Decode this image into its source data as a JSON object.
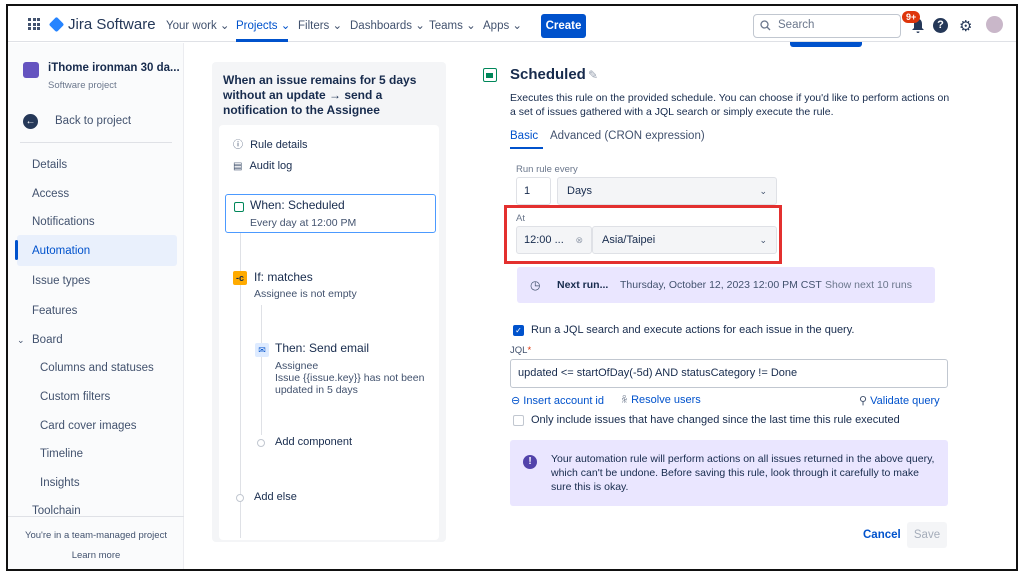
{
  "topnav": {
    "brand": "Jira Software",
    "items": [
      "Your work",
      "Projects",
      "Filters",
      "Dashboards",
      "Teams",
      "Apps"
    ],
    "create_label": "Create",
    "search_placeholder": "Search",
    "notification_badge": "9+",
    "help_label": "?"
  },
  "sidebar": {
    "project_name": "iThome ironman 30 da...",
    "project_type": "Software project",
    "back_label": "Back to project",
    "items": [
      "Details",
      "Access",
      "Notifications",
      "Automation",
      "Issue types",
      "Features"
    ],
    "board_label": "Board",
    "board_items": [
      "Columns and statuses",
      "Custom filters",
      "Card cover images",
      "Timeline",
      "Insights"
    ],
    "toolchain_label": "Toolchain",
    "footer_text": "You're in a team-managed project",
    "learn_more": "Learn more"
  },
  "rule": {
    "title": "When an issue remains for 5 days without an update → send a notification to the Assignee",
    "details_label": "Rule details",
    "audit_label": "Audit log",
    "when_title": "When: Scheduled",
    "when_sub": "Every day at 12:00 PM",
    "if_title": "If: matches",
    "if_sub": "Assignee is not empty",
    "then_title": "Then: Send email",
    "then_line1": "Assignee",
    "then_line2": "Issue {{issue.key}} has not been",
    "then_line3": "updated in 5 days",
    "add_component": "Add component",
    "add_else": "Add else"
  },
  "schedule": {
    "title": "Scheduled",
    "description": "Executes this rule on the provided schedule. You can choose if you'd like to perform actions on a set of issues gathered with a JQL search or simply execute the rule.",
    "tab_basic": "Basic",
    "tab_advanced": "Advanced (CRON expression)",
    "run_every_label": "Run rule every",
    "run_every_value": "1",
    "run_every_unit": "Days",
    "at_label": "At",
    "at_time": "12:00 ...",
    "timezone": "Asia/Taipei",
    "next_run_label": "Next run...",
    "next_run_value": "Thursday, October 12, 2023 12:00 PM CST",
    "show_next": "Show next 10 runs",
    "jql_checkbox_label": "Run a JQL search and execute actions for each issue in the query.",
    "jql_label": "JQL",
    "jql_required": "*",
    "jql_value": "updated <= startOfDay(-5d) AND statusCategory != Done",
    "insert_account": "Insert account id",
    "resolve_users": "Resolve users",
    "validate_query": "Validate query",
    "only_changed_label": "Only include issues that have changed since the last time this rule executed",
    "warning": "Your automation rule will perform actions on all issues returned in the above query, which can't be undone. Before saving this rule, look through it carefully to make sure this is okay.",
    "cancel_label": "Cancel",
    "save_label": "Save"
  }
}
